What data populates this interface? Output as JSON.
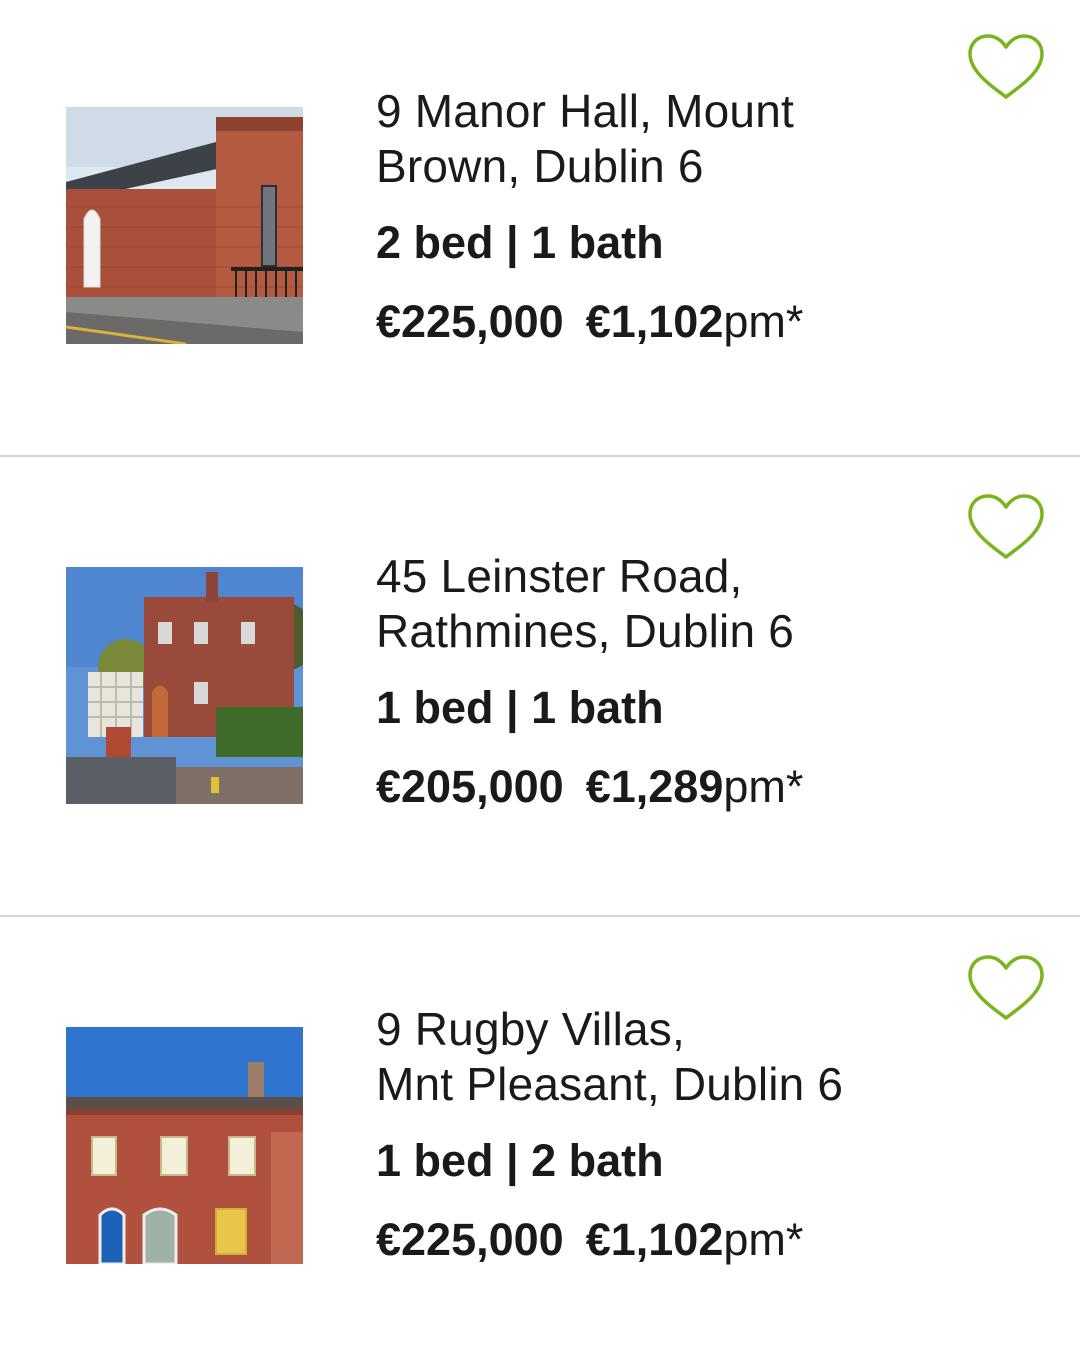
{
  "accent_color": "#7ab51d",
  "listings": [
    {
      "address_line1": "9 Manor Hall, Mount",
      "address_line2": "Brown, Dublin 6",
      "specs": "2 bed | 1 bath",
      "price": "€225,000",
      "monthly": "€1,102",
      "monthly_suffix": "pm*",
      "favourite_icon": "heart-outline-icon"
    },
    {
      "address_line1": "45 Leinster Road,",
      "address_line2": "Rathmines, Dublin 6",
      "specs": "1 bed | 1 bath",
      "price": "€205,000",
      "monthly": "€1,289",
      "monthly_suffix": "pm*",
      "favourite_icon": "heart-outline-icon"
    },
    {
      "address_line1": "9 Rugby Villas,",
      "address_line2": "Mnt Pleasant, Dublin 6",
      "specs": "1 bed | 2 bath",
      "price": "€225,000",
      "monthly": "€1,102",
      "monthly_suffix": "pm*",
      "favourite_icon": "heart-outline-icon"
    }
  ]
}
